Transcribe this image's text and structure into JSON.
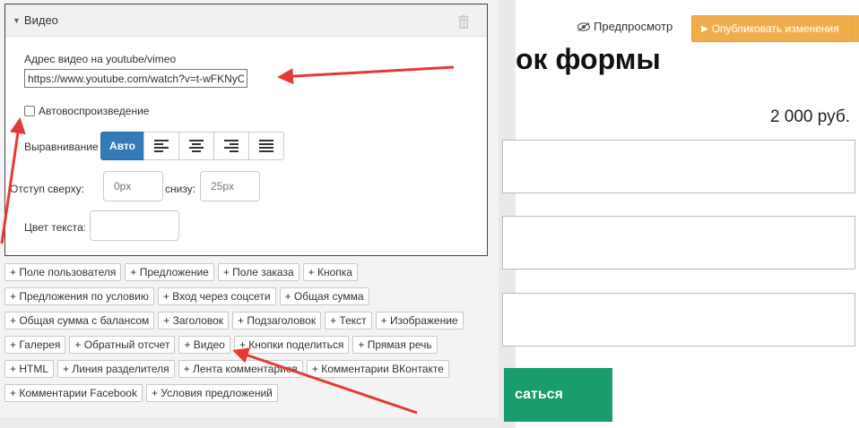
{
  "panel": {
    "header_title": "Видео",
    "url_label": "Адрес видео на youtube/vimeo",
    "url_value": "https://www.youtube.com/watch?v=t-wFKNyC",
    "autoplay_label": "Автовоспроизведение",
    "alignment_label": "Выравнивание",
    "alignment_auto": "Авто",
    "alignment_options": [
      "align-left-icon",
      "align-center-icon",
      "align-right-icon",
      "align-justify-icon"
    ],
    "margin_top_label": "Отступ сверху:",
    "margin_top_placeholder": "0px",
    "margin_bottom_label": "снизу:",
    "margin_bottom_placeholder": "25px",
    "text_color_label": "Цвет текста:"
  },
  "chips": [
    [
      "+ Поле пользователя",
      "+ Предложение",
      "+ Поле заказа",
      "+ Кнопка"
    ],
    [
      "+ Предложения по условию",
      "+ Вход через соцсети",
      "+ Общая сумма"
    ],
    [
      "+ Общая сумма с балансом",
      "+ Заголовок",
      "+ Подзаголовок",
      "+ Текст",
      "+ Изображение"
    ],
    [
      "+ Галерея",
      "+ Обратный отсчет",
      "+ Видео",
      "+ Кнопки поделиться",
      "+ Прямая речь"
    ],
    [
      "+ HTML",
      "+ Линия разделителя",
      "+ Лента комментариев",
      "+ Комментарии ВКонтакте"
    ],
    [
      "+ Комментарии Facebook",
      "+ Условия предложений"
    ]
  ],
  "topbar": {
    "preview_label": "Предпросмотр",
    "publish_label": "Опубликовать изменения"
  },
  "preview": {
    "heading_fragment": "ок формы",
    "price": "2 000 руб.",
    "submit_fragment": "саться"
  },
  "colors": {
    "accent_blue": "#337ab7",
    "publish_orange": "#f0ad4e",
    "submit_green": "#1a9c6c",
    "arrow_red": "#e53935"
  }
}
